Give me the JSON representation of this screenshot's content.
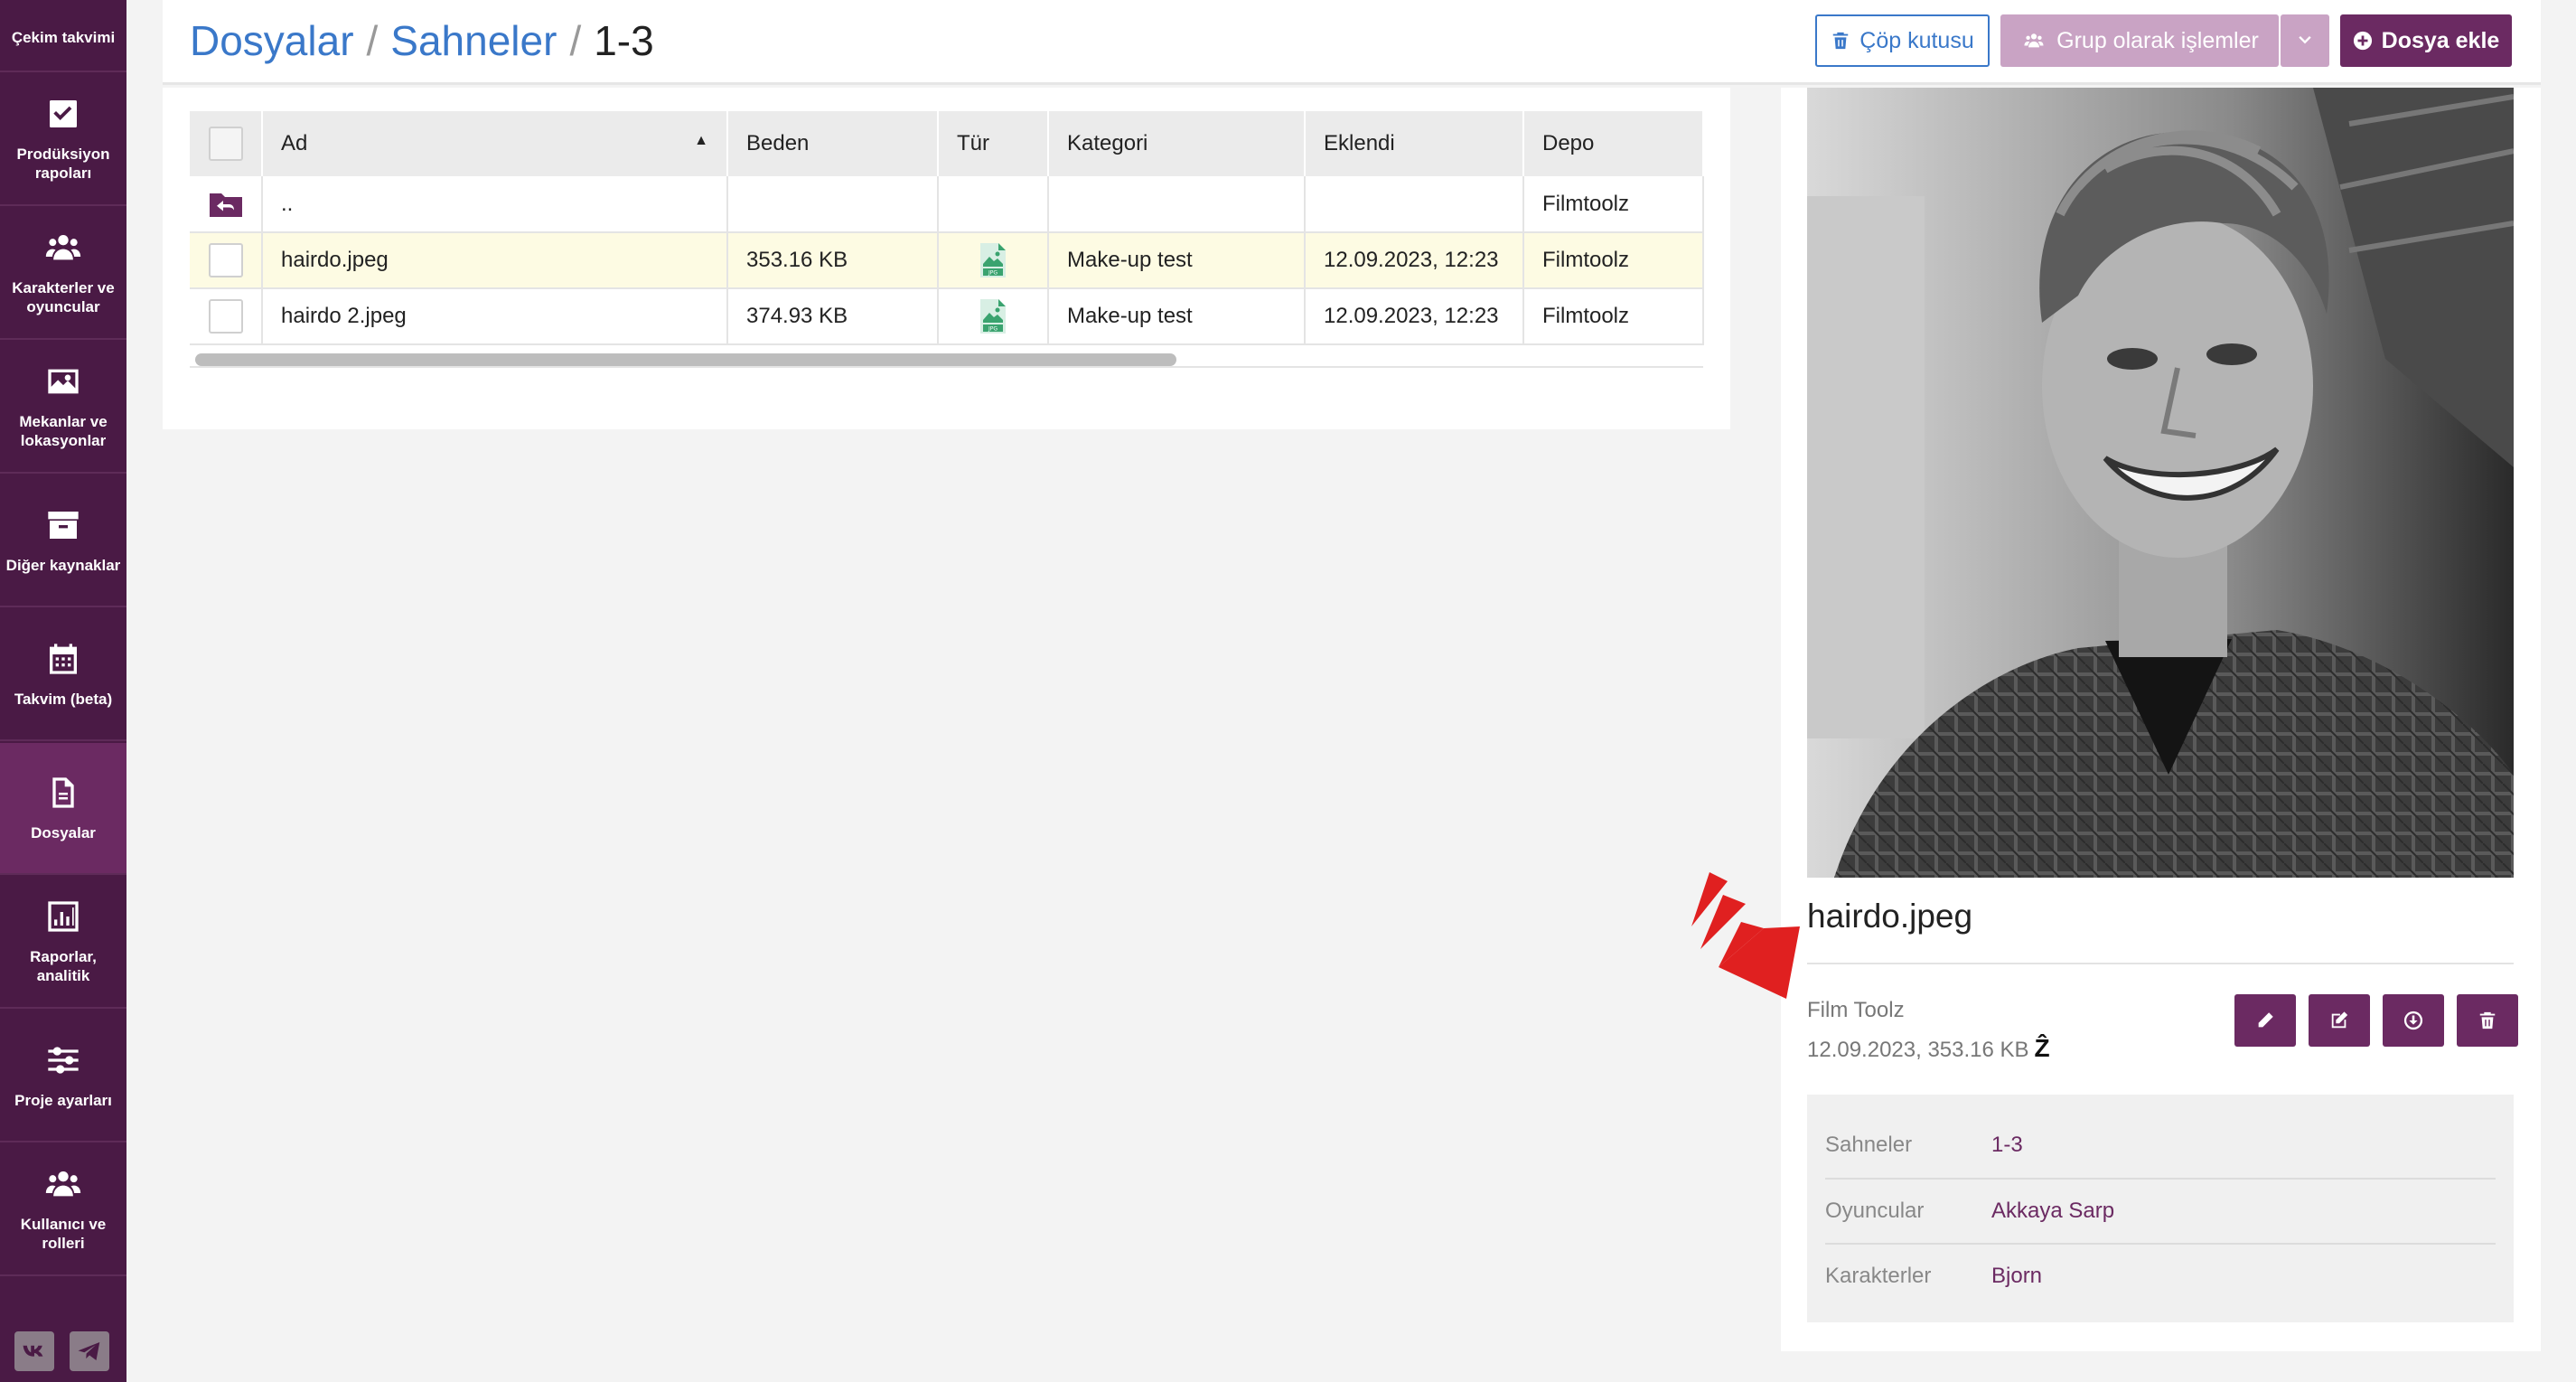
{
  "sidebar": {
    "items": [
      {
        "label": "Çekim takvimi",
        "icon": "calendar-icon"
      },
      {
        "label": "Prodüksiyon rapoları",
        "icon": "checkbox-icon"
      },
      {
        "label": "Karakterler ve oyuncular",
        "icon": "users-icon"
      },
      {
        "label": "Mekanlar ve lokasyonlar",
        "icon": "image-icon"
      },
      {
        "label": "Diğer kaynaklar",
        "icon": "archive-icon"
      },
      {
        "label": "Takvim (beta)",
        "icon": "calendar-grid-icon"
      },
      {
        "label": "Dosyalar",
        "icon": "file-icon",
        "active": true
      },
      {
        "label": "Raporlar, analitik",
        "icon": "bar-chart-icon"
      },
      {
        "label": "Proje ayarları",
        "icon": "sliders-icon"
      },
      {
        "label": "Kullanıcı ve rolleri",
        "icon": "users-icon"
      }
    ],
    "social": [
      "vk-icon",
      "telegram-icon"
    ]
  },
  "breadcrumb": {
    "root": "Dosyalar",
    "parent": "Sahneler",
    "current": "1-3",
    "separator": "/"
  },
  "toolbar": {
    "trash_label": "Çöp kutusu",
    "group_label": "Grup olarak işlemler",
    "add_label": "Dosya ekle"
  },
  "table": {
    "columns": [
      "Ad",
      "Beden",
      "Tür",
      "Kategori",
      "Eklendi",
      "Depo"
    ],
    "sort": {
      "column": "Ad",
      "direction": "asc"
    },
    "parent_row": {
      "name": "..",
      "storage": "Filmtoolz"
    },
    "rows": [
      {
        "name": "hairdo.jpeg",
        "size": "353.16 KB",
        "type": "jpg-icon",
        "category": "Make-up test",
        "added": "12.09.2023, 12:23",
        "storage": "Filmtoolz",
        "highlighted": true
      },
      {
        "name": "hairdo 2.jpeg",
        "size": "374.93 KB",
        "type": "jpg-icon",
        "category": "Make-up test",
        "added": "12.09.2023, 12:23",
        "storage": "Filmtoolz",
        "highlighted": false
      }
    ]
  },
  "preview": {
    "title": "hairdo.jpeg",
    "owner": "Film Toolz",
    "meta": "12.09.2023, 353.16 KB",
    "meta_mark": "Ẑ",
    "details": [
      {
        "key": "Sahneler",
        "value": "1-3"
      },
      {
        "key": "Oyuncular",
        "value": "Akkaya Sarp"
      },
      {
        "key": "Karakterler",
        "value": "Bjorn"
      }
    ]
  },
  "colors": {
    "sidebar": "#4a1a45",
    "accent": "#6b2a62",
    "link": "#3a78c9",
    "group_button": "#c9a3c4",
    "highlight_row": "#fdfbe3",
    "annotation_arrow": "#e02020"
  }
}
